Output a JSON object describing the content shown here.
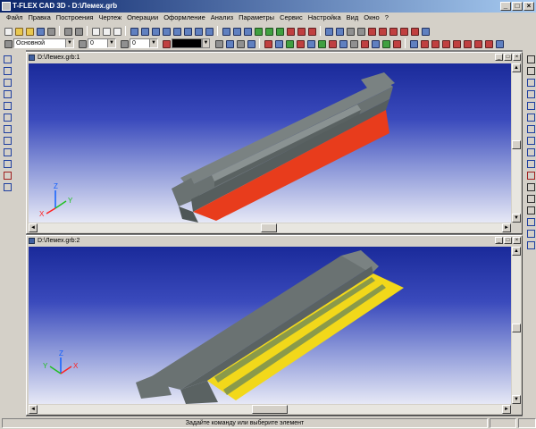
{
  "window": {
    "title": "T-FLEX CAD 3D - D:\\Лемех.grb"
  },
  "menu": [
    "Файл",
    "Правка",
    "Построения",
    "Чертеж",
    "Операции",
    "Оформление",
    "Анализ",
    "Параметры",
    "Сервис",
    "Настройка",
    "Вид",
    "Окно",
    "?"
  ],
  "toolbar2": {
    "layer_value": "Основной",
    "field1_value": "0",
    "field2_value": "0"
  },
  "documents": [
    {
      "title": "D:\\Лемех.grb:1",
      "highlight_color": "#e83c1c"
    },
    {
      "title": "D:\\Лемех.grb:2",
      "highlight_color": "#f2d81a"
    }
  ],
  "axes": {
    "x": "X",
    "y": "Y",
    "z": "Z"
  },
  "status": {
    "message": "Задайте команду или выберите элемент"
  },
  "colors": {
    "model_body": "#6a7272",
    "model_shade": "#4e5656",
    "background_top": "#1a2a9a"
  }
}
